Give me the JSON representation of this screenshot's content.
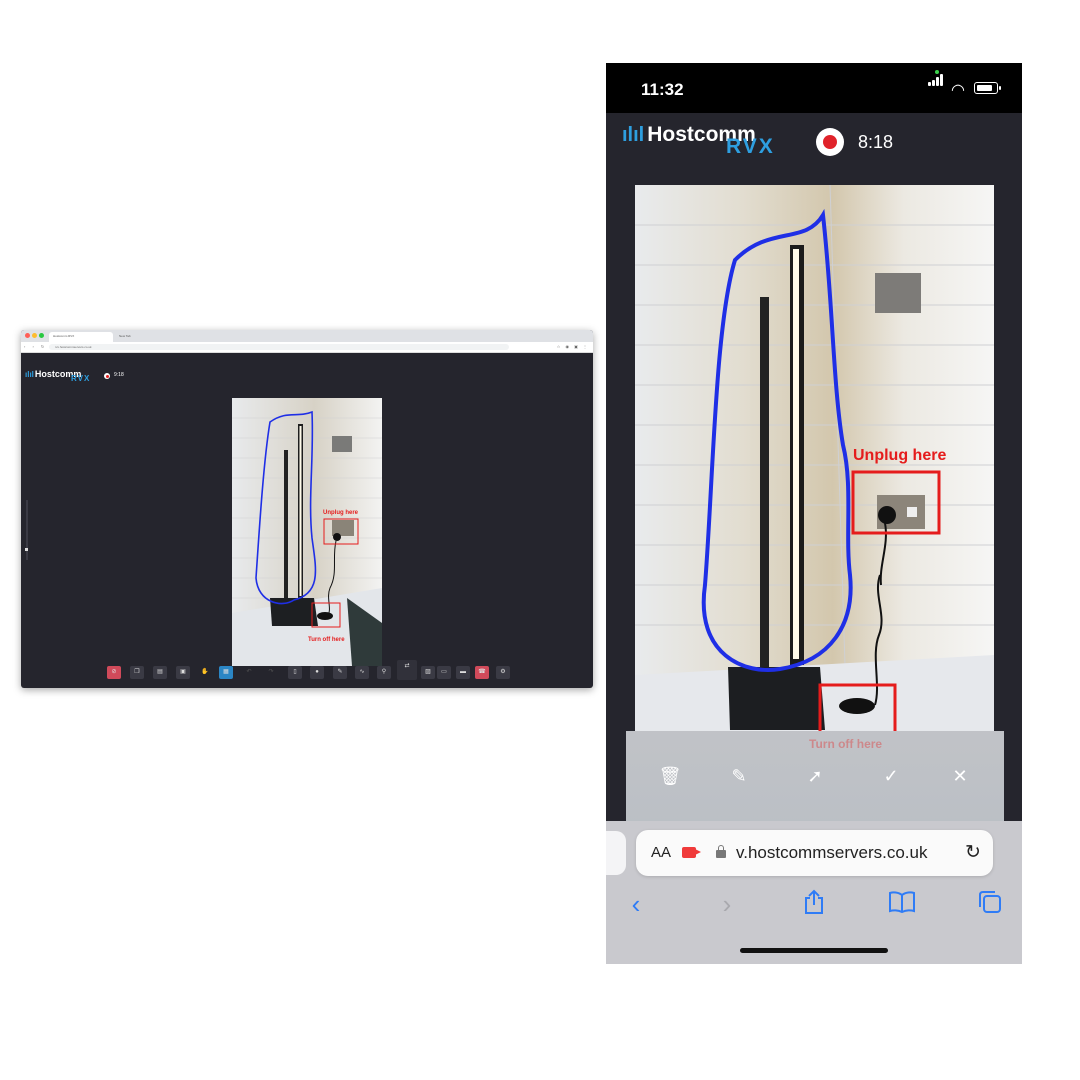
{
  "desktop": {
    "tabs": [
      {
        "label": "Hostcomm RVX"
      },
      {
        "label": "New Tab"
      }
    ],
    "url": "rvx.hostcommservers.co.uk",
    "app": {
      "logo": "Hostcomm",
      "logo_sub": "RVX",
      "timer": "9:18"
    },
    "annotations": {
      "unplug": "Unplug here",
      "turn_off": "Turn off here"
    },
    "toolbar_icons": [
      "mic-off-icon",
      "copy-icon",
      "doc-icon",
      "save-icon",
      "pointer-icon",
      "screen-share-icon",
      "undo-icon",
      "redo-icon",
      "flashlight-icon",
      "record-icon",
      "pen-icon",
      "signature-icon",
      "pin-icon",
      "camera-flip-icon",
      "image-icon",
      "chat-icon",
      "minimize-icon",
      "hang-up-icon",
      "settings-icon"
    ]
  },
  "mobile": {
    "status": {
      "time": "11:32"
    },
    "app": {
      "logo": "Hostcomm",
      "logo_sub": "RVX",
      "timer": "8:18"
    },
    "annotations": {
      "unplug": "Unplug here",
      "turn_off": "Turn off here"
    },
    "annotation_toolbar": [
      "trash-icon",
      "edit-icon",
      "pointer-icon",
      "check-icon",
      "close-icon"
    ],
    "browser": {
      "text_size": "AA",
      "url": "v.hostcommservers.co.uk"
    }
  },
  "colors": {
    "app_bg": "#25252d",
    "brand_blue": "#2e9fe0",
    "annotation_red": "#e51c1c",
    "annotation_blue": "#1f2fe6",
    "safari_blue": "#2f7cf6"
  }
}
